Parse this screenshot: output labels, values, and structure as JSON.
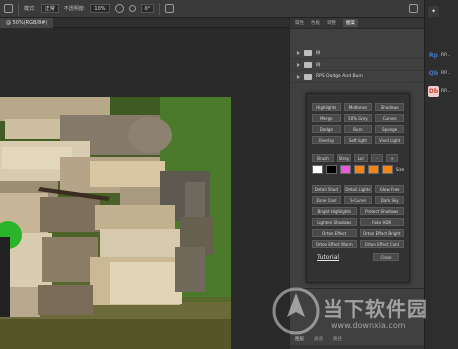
{
  "options_bar": {
    "mode_label": "模式:",
    "mode_value": "正常",
    "opacity_label": "不透明度:",
    "opacity_value": "10%",
    "angle_value": "0°"
  },
  "document": {
    "tab_label": "@ 50%(RGB/8#)"
  },
  "panel_tabs": [
    "属性",
    "色板",
    "调整",
    "图案"
  ],
  "panel_folders": [
    "树",
    "树",
    "RPS Dodge And Burn"
  ],
  "plugin": {
    "grid": [
      [
        "Highlights",
        "Midtones",
        "Shadows"
      ],
      [
        "Merge",
        "50% Grey",
        "Curves"
      ],
      [
        "Dodge",
        "Burn",
        "Sponge"
      ],
      [
        "Overlay",
        "Soft light",
        "Vivid Light"
      ]
    ],
    "brush_row": [
      "Brush",
      "Stroy",
      "Lor",
      "-",
      "+"
    ],
    "swatches": [
      "#ffffff",
      "#000000",
      "#e85bd8",
      "#f2851a",
      "#f2851a",
      "#f2851a"
    ],
    "size_label": "Size",
    "actions": [
      [
        "Detail Shad",
        "Detail Lights",
        "Glow Free"
      ],
      [
        "Zone Cool",
        "S-Curve",
        "Dark Sky"
      ],
      [
        "Bright Highlights",
        "Protect Shadows"
      ],
      [
        "Lighten Shadows",
        "Fake HDR"
      ],
      [
        "Orton Effect",
        "Orton Effect Bright"
      ],
      [
        "Orton Effect Warm",
        "Orton Effect Cold"
      ]
    ],
    "tutorial_label": "Tutorial",
    "close_label": "Close"
  },
  "layers": {
    "labels": [
      "图层",
      "通道",
      "路径"
    ]
  },
  "right_strip": [
    {
      "icon": "lightbulb-icon",
      "label": ""
    },
    {
      "icon": "rp-icon",
      "label": "RP..."
    },
    {
      "icon": "qb-icon",
      "label": "RP..."
    },
    {
      "icon": "db-icon",
      "label": "RP..."
    }
  ],
  "watermark": {
    "title": "当下软件园",
    "url": "www.downxia.com"
  },
  "colors": {
    "accent_db": "#c8483c",
    "accent_rp": "#4a78c0",
    "magenta": "#e85bd8",
    "orange": "#f2851a"
  }
}
